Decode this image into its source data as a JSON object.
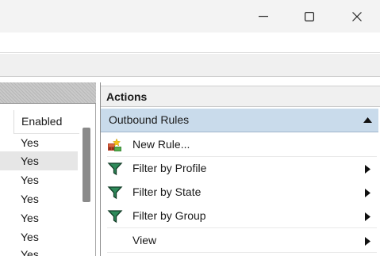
{
  "window": {
    "controls": [
      "minimize",
      "maximize",
      "close"
    ]
  },
  "left_pane": {
    "column_header": "Enabled",
    "rows": [
      "Yes",
      "Yes",
      "Yes",
      "Yes",
      "Yes",
      "Yes",
      "Yes"
    ],
    "selected_row_index": 1
  },
  "actions_pane": {
    "title": "Actions",
    "section": {
      "label": "Outbound Rules",
      "state": "expanded"
    },
    "items": [
      {
        "label": "New Rule...",
        "icon": "new-rule-icon",
        "submenu": false
      },
      {
        "label": "Filter by Profile",
        "icon": "filter-icon",
        "submenu": true
      },
      {
        "label": "Filter by State",
        "icon": "filter-icon",
        "submenu": true
      },
      {
        "label": "Filter by Group",
        "icon": "filter-icon",
        "submenu": true
      },
      {
        "label": "View",
        "icon": "",
        "submenu": true
      }
    ]
  },
  "colors": {
    "section_highlight": "#c9dbeb",
    "titlebar": "#f3f3f3",
    "filter_icon": "#1e6d45"
  }
}
